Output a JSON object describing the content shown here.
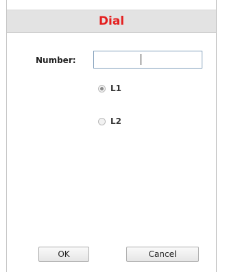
{
  "dialog": {
    "title": "Dial",
    "title_color": "#e41f1f",
    "number": {
      "label": "Number:",
      "value": "",
      "placeholder": ""
    },
    "lines": [
      {
        "label": "L1",
        "checked": true
      },
      {
        "label": "L2",
        "checked": false
      }
    ],
    "buttons": {
      "ok_label": "OK",
      "cancel_label": "Cancel"
    }
  }
}
